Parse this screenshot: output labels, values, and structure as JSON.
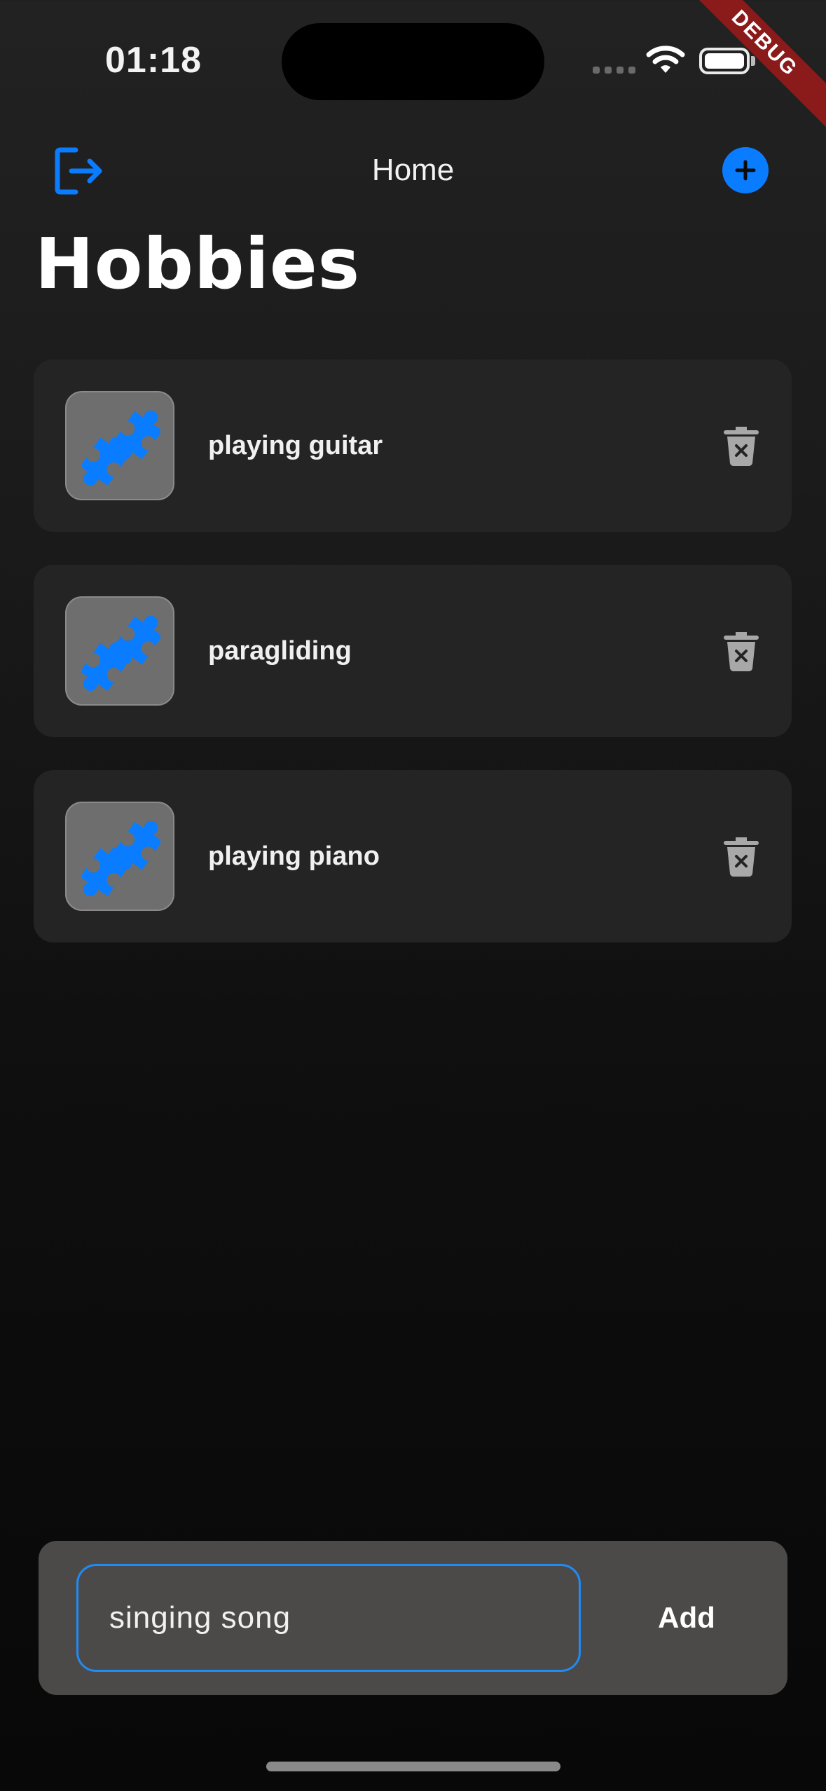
{
  "status_bar": {
    "time": "01:18"
  },
  "debug_banner": "DEBUG",
  "nav": {
    "title": "Home"
  },
  "page": {
    "title": "Hobbies"
  },
  "hobbies": [
    {
      "label": "playing guitar"
    },
    {
      "label": "paragliding"
    },
    {
      "label": "playing piano"
    }
  ],
  "composer": {
    "input_value": "singing song",
    "add_label": "Add"
  },
  "colors": {
    "accent": "#0a7cff",
    "card_bg": "#242424",
    "thumb_bg": "#6e6e6e",
    "input_border": "#1f8bf5"
  },
  "icons": {
    "logout": "logout-icon",
    "add": "plus-circle-icon",
    "thumb": "puzzle-icon",
    "delete": "trash-icon"
  }
}
